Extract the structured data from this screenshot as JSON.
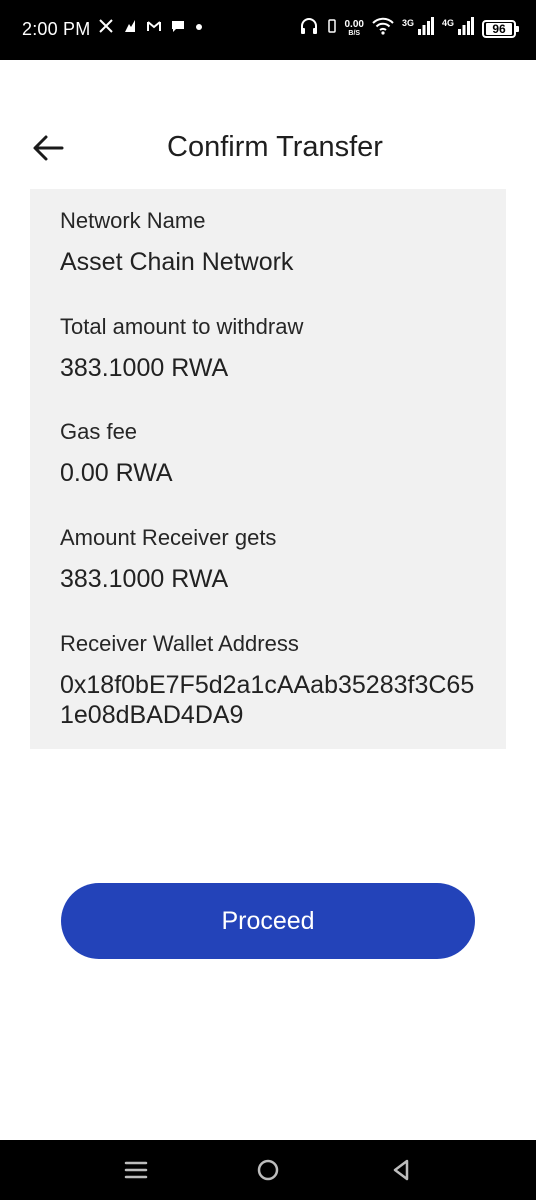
{
  "status_bar": {
    "time": "2:00 PM",
    "left_icons": [
      "x-icon",
      "app-icon",
      "gmail-icon",
      "chat-icon",
      "dot-icon"
    ],
    "net_speed_value": "0.00",
    "net_speed_unit": "B/S",
    "signal_1_label": "3G",
    "signal_2_label": "4G",
    "battery_level": "96"
  },
  "header": {
    "title": "Confirm Transfer"
  },
  "details": [
    {
      "label": "Network Name",
      "value": "Asset Chain Network"
    },
    {
      "label": "Total amount to withdraw",
      "value": "383.1000 RWA"
    },
    {
      "label": "Gas fee",
      "value": "0.00 RWA"
    },
    {
      "label": "Amount Receiver gets",
      "value": "383.1000 RWA"
    },
    {
      "label": "Receiver Wallet Address",
      "value": "0x18f0bE7F5d2a1cAAab35283f3C651e08dBAD4DA9"
    }
  ],
  "actions": {
    "proceed_label": "Proceed"
  },
  "colors": {
    "primary_button": "#2343b9",
    "card_background": "#f1f1f1",
    "status_bar": "#000000"
  },
  "nav_bar": {
    "buttons": [
      "menu-icon",
      "home-icon",
      "back-triangle-icon"
    ]
  }
}
